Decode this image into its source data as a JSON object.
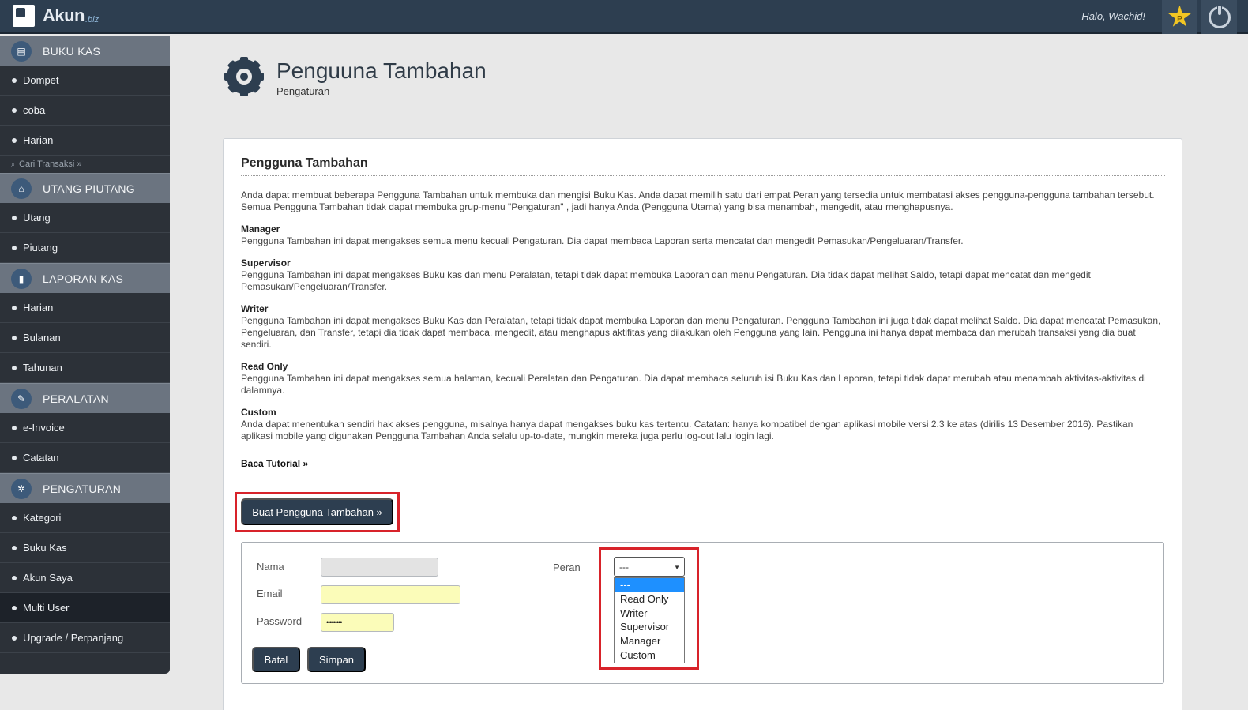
{
  "topbar": {
    "logo_text": "Akun",
    "logo_sub": ".biz",
    "greeting": "Halo, Wachid!",
    "star_letter": "P"
  },
  "sidebar": {
    "sections": [
      {
        "title": "BUKU KAS",
        "icon": "book-icon",
        "glyph": "▤",
        "items": [
          "Dompet",
          "coba",
          "Harian"
        ],
        "search": "Cari Transaksi »"
      },
      {
        "title": "UTANG PIUTANG",
        "icon": "bank-icon",
        "glyph": "⌂",
        "items": [
          "Utang",
          "Piutang"
        ]
      },
      {
        "title": "LAPORAN KAS",
        "icon": "bar-chart-icon",
        "glyph": "▮",
        "items": [
          "Harian",
          "Bulanan",
          "Tahunan"
        ]
      },
      {
        "title": "PERALATAN",
        "icon": "wrench-icon",
        "glyph": "✎",
        "items": [
          "e-Invoice",
          "Catatan"
        ]
      },
      {
        "title": "PENGATURAN",
        "icon": "cog-icon",
        "glyph": "✲",
        "items": [
          "Kategori",
          "Buku Kas",
          "Akun Saya",
          "Multi User",
          "Upgrade / Perpanjang"
        ]
      }
    ],
    "active_item": "Multi User"
  },
  "header": {
    "title": "Penguuna Tambahan",
    "subtitle": "Pengaturan"
  },
  "card": {
    "title": "Pengguna Tambahan",
    "intro": "Anda dapat membuat beberapa Pengguna Tambahan untuk membuka dan mengisi Buku Kas. Anda dapat memilih satu dari empat Peran yang tersedia untuk membatasi akses pengguna-pengguna tambahan tersebut. Semua Pengguna Tambahan tidak dapat membuka grup-menu \"Pengaturan\" , jadi hanya Anda (Pengguna Utama) yang bisa menambah, mengedit, atau menghapusnya.",
    "roles": [
      {
        "name": "Manager",
        "desc": "Pengguna Tambahan ini dapat mengakses semua menu kecuali Pengaturan. Dia dapat membaca Laporan serta mencatat dan mengedit Pemasukan/Pengeluaran/Transfer."
      },
      {
        "name": "Supervisor",
        "desc": "Pengguna Tambahan ini dapat mengakses Buku kas dan menu Peralatan, tetapi tidak dapat membuka Laporan dan menu Pengaturan. Dia tidak dapat melihat Saldo, tetapi dapat mencatat dan mengedit Pemasukan/Pengeluaran/Transfer."
      },
      {
        "name": "Writer",
        "desc": "Pengguna Tambahan ini dapat mengakses Buku Kas dan Peralatan, tetapi tidak dapat membuka Laporan dan menu Pengaturan. Pengguna Tambahan ini juga tidak dapat melihat Saldo. Dia dapat mencatat Pemasukan, Pengeluaran, dan Transfer, tetapi dia tidak dapat membaca, mengedit, atau menghapus aktifitas yang dilakukan oleh Pengguna yang lain. Pengguna ini hanya dapat membaca dan merubah transaksi yang dia buat sendiri."
      },
      {
        "name": "Read Only",
        "desc": "Pengguna Tambahan ini dapat mengakses semua halaman, kecuali Peralatan dan Pengaturan. Dia dapat membaca seluruh isi Buku Kas dan Laporan, tetapi tidak dapat merubah atau menambah aktivitas-aktivitas di dalamnya."
      },
      {
        "name": "Custom",
        "desc": "Anda dapat menentukan sendiri hak akses pengguna, misalnya hanya dapat mengakses buku kas tertentu. Catatan: hanya kompatibel dengan aplikasi mobile versi 2.3 ke atas (dirilis 13 Desember 2016). Pastikan aplikasi mobile yang digunakan Pengguna Tambahan Anda selalu up-to-date, mungkin mereka juga perlu log-out lalu login lagi."
      }
    ],
    "tutorial_link": "Baca Tutorial »",
    "create_button": "Buat Pengguna Tambahan »"
  },
  "form": {
    "name_label": "Nama",
    "name_value": "",
    "email_label": "Email",
    "email_value": "",
    "password_label": "Password",
    "password_value": "•••••••••",
    "role_label": "Peran",
    "role_selected": "---",
    "role_options": [
      "---",
      "Read Only",
      "Writer",
      "Supervisor",
      "Manager",
      "Custom"
    ],
    "cancel_button": "Batal",
    "save_button": "Simpan"
  },
  "colors": {
    "topbar": "#2d3e50",
    "sidebar": "#2c3138",
    "highlight": "#d8232a",
    "input_yellow": "#fbfcb9",
    "selected_option": "#1e90ff"
  }
}
